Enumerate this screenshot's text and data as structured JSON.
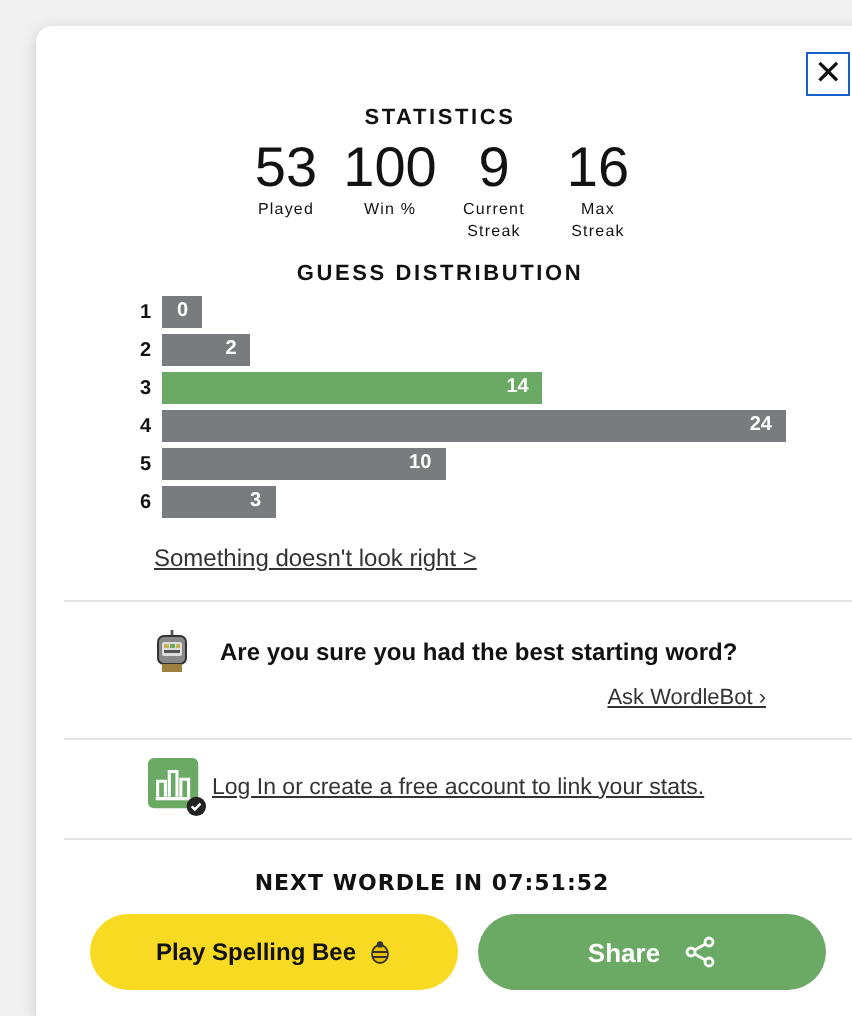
{
  "close_button": {
    "label": "✕"
  },
  "statistics": {
    "title": "STATISTICS",
    "items": [
      {
        "value": "53",
        "label": "Played"
      },
      {
        "value": "100",
        "label": "Win %"
      },
      {
        "value": "9",
        "label": "Current Streak"
      },
      {
        "value": "16",
        "label": "Max Streak"
      }
    ]
  },
  "guess_distribution": {
    "title": "GUESS DISTRIBUTION",
    "rows": [
      {
        "guess": "1",
        "count": "0",
        "selected": false
      },
      {
        "guess": "2",
        "count": "2",
        "selected": false
      },
      {
        "guess": "3",
        "count": "14",
        "selected": true
      },
      {
        "guess": "4",
        "count": "24",
        "selected": false
      },
      {
        "guess": "5",
        "count": "10",
        "selected": false
      },
      {
        "guess": "6",
        "count": "3",
        "selected": false
      }
    ]
  },
  "feedback_link": "Something doesn't look right >",
  "wordlebot": {
    "question": "Are you sure you had the best starting word?",
    "link": "Ask WordleBot ›"
  },
  "account_link": "Log In or create a free account to link your stats.",
  "countdown": "NEXT WORDLE IN 07:51:52",
  "buttons": [
    {
      "kind": "spelling-bee",
      "label": "Play Spelling Bee"
    },
    {
      "kind": "share",
      "label": "Share"
    }
  ]
}
